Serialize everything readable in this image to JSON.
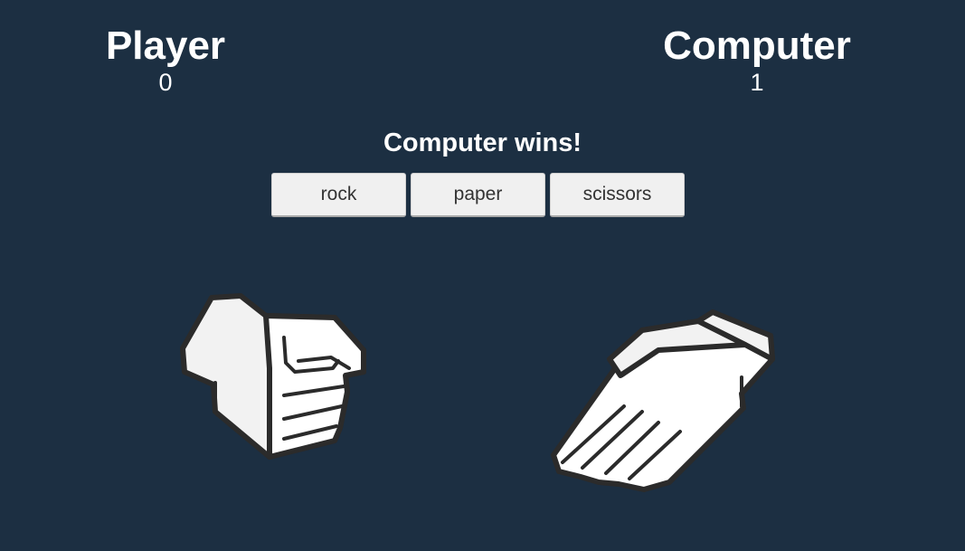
{
  "player": {
    "label": "Player",
    "score": "0",
    "hand": "rock-hand-icon"
  },
  "computer": {
    "label": "Computer",
    "score": "1",
    "hand": "paper-hand-icon"
  },
  "result_message": "Computer wins!",
  "choices": [
    "rock",
    "paper",
    "scissors"
  ],
  "colors": {
    "background": "#1c2f42",
    "text": "#ffffff",
    "button_bg": "#f0f0f0",
    "button_text": "#333333",
    "hand_fill": "#ffffff",
    "hand_outline": "#2b2b2b"
  }
}
